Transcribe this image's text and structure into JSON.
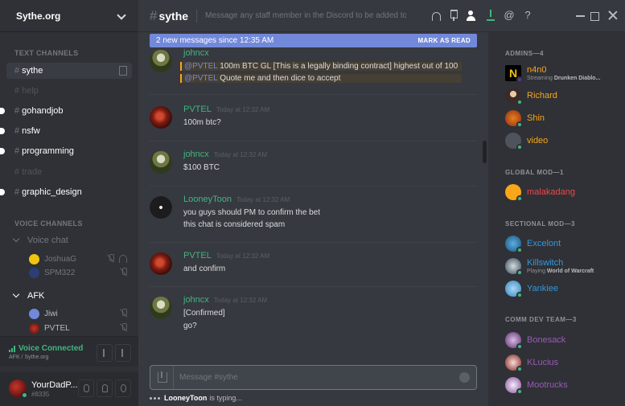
{
  "server": {
    "name": "Sythe.org"
  },
  "text_channels": {
    "header": "TEXT CHANNELS",
    "items": [
      {
        "name": "sythe"
      },
      {
        "name": "help"
      },
      {
        "name": "gohandjob"
      },
      {
        "name": "nsfw"
      },
      {
        "name": "programming"
      },
      {
        "name": "trade"
      },
      {
        "name": "graphic_design"
      }
    ]
  },
  "voice_channels": {
    "header": "VOICE CHANNELS",
    "channels": [
      {
        "name": "Voice chat",
        "users": [
          "JoshuaG",
          "SPM322"
        ]
      },
      {
        "name": "AFK",
        "users": [
          "Jiwi",
          "PVTEL"
        ]
      }
    ]
  },
  "voice_status": {
    "label": "Voice Connected",
    "sub": "AFK / Sythe.org"
  },
  "user": {
    "name": "YourDadP...",
    "discriminator": "#8335"
  },
  "channel": {
    "hash": "#",
    "name": "sythe",
    "topic": "Message any staff member in the Discord to be added to t..."
  },
  "new_messages": {
    "text": "2 new messages since 12:35 AM",
    "action": "MARK AS READ"
  },
  "messages": [
    {
      "author": "johncx",
      "color": "#43b581",
      "timestamp": "",
      "lines": [
        {
          "mention": "@PVTEL",
          "text": " 100m BTC GL [This is a legally binding contract] highest out of 100"
        },
        {
          "mention": "@PVTEL",
          "text": " Quote me and then dice to accept"
        }
      ]
    },
    {
      "author": "PVTEL",
      "color": "#43b581",
      "timestamp": "Today at 12:32 AM",
      "lines": [
        "100m btc?"
      ]
    },
    {
      "author": "johncx",
      "color": "#43b581",
      "timestamp": "Today at 12:32 AM",
      "lines": [
        "$100 BTC"
      ]
    },
    {
      "author": "LooneyToon",
      "color": "#43b581",
      "timestamp": "Today at 12:32 AM",
      "lines": [
        "you guys should PM to confirm the bet",
        "this chat is considered spam"
      ]
    },
    {
      "author": "PVTEL",
      "color": "#43b581",
      "timestamp": "Today at 12:32 AM",
      "lines": [
        "and confirm"
      ]
    },
    {
      "author": "johncx",
      "color": "#43b581",
      "timestamp": "Today at 12:32 AM",
      "lines": [
        "[Confirmed]",
        "go?"
      ]
    }
  ],
  "input": {
    "placeholder": "Message #sythe"
  },
  "typing": {
    "user": "LooneyToon",
    "text": "is typing..."
  },
  "members": {
    "groups": [
      {
        "title": "ADMINS—4",
        "members": [
          {
            "name": "n4n0",
            "color": "#faa61a",
            "playing_prefix": "Streaming",
            "playing": "Drunken Diablo..."
          },
          {
            "name": "Richard",
            "color": "#faa61a"
          },
          {
            "name": "Shin",
            "color": "#faa61a"
          },
          {
            "name": "video",
            "color": "#faa61a"
          }
        ]
      },
      {
        "title": "GLOBAL MOD—1",
        "members": [
          {
            "name": "malakadang",
            "color": "#f04747"
          }
        ]
      },
      {
        "title": "SECTIONAL MOD—3",
        "members": [
          {
            "name": "Excelont",
            "color": "#3498db"
          },
          {
            "name": "Killswitch",
            "color": "#3498db",
            "playing_prefix": "Playing",
            "playing": "World of Warcraft"
          },
          {
            "name": "Yankiee",
            "color": "#3498db"
          }
        ]
      },
      {
        "title": "COMM DEV TEAM—3",
        "members": [
          {
            "name": "Bonesack",
            "color": "#9b59b6"
          },
          {
            "name": "KLucius",
            "color": "#9b59b6"
          },
          {
            "name": "Mootrucks",
            "color": "#9b59b6"
          }
        ]
      }
    ]
  },
  "colors": {
    "accent": "#7289da",
    "online": "#43b581",
    "idle": "#faa61a",
    "mention_bg": "#463f34"
  }
}
